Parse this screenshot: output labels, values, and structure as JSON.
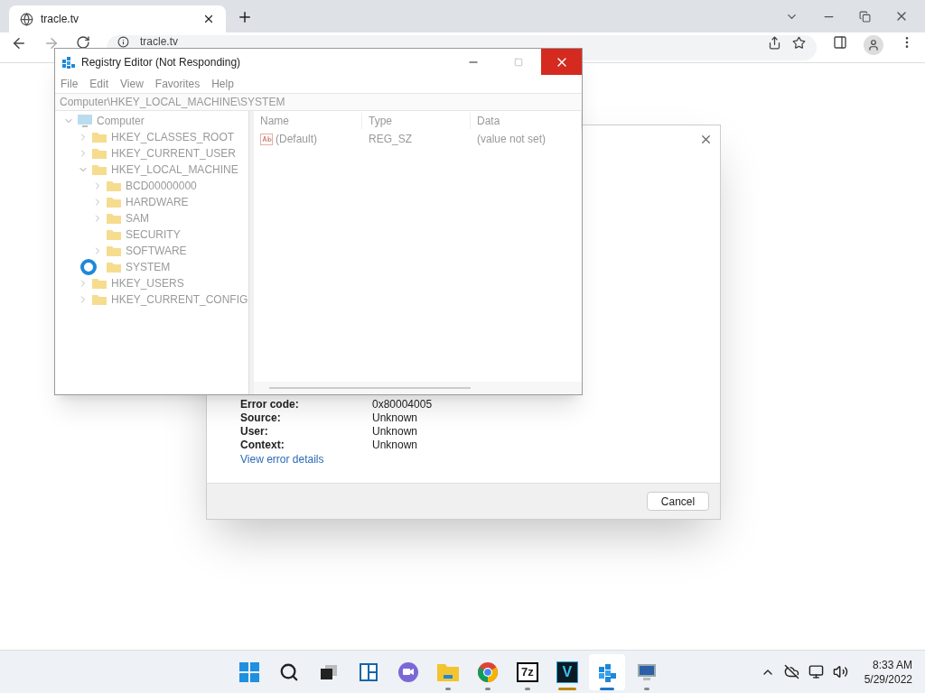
{
  "browser": {
    "tabs": [
      {
        "title": "tracle.tv",
        "selected": true
      }
    ],
    "address": "tracle.tv"
  },
  "dialog": {
    "rows": [
      {
        "label": "Error code:",
        "value": "0x80004005"
      },
      {
        "label": "Source:",
        "value": "Unknown"
      },
      {
        "label": "User:",
        "value": "Unknown"
      },
      {
        "label": "Context:",
        "value": "Unknown"
      }
    ],
    "link": "View error details",
    "button": "Cancel"
  },
  "regedit": {
    "title": "Registry Editor (Not Responding)",
    "menu": [
      "File",
      "Edit",
      "View",
      "Favorites",
      "Help"
    ],
    "address": "Computer\\HKEY_LOCAL_MACHINE\\SYSTEM",
    "tree": [
      {
        "label": "Computer",
        "kind": "computer",
        "expanded": true,
        "children": [
          {
            "label": "HKEY_CLASSES_ROOT",
            "expanded": false
          },
          {
            "label": "HKEY_CURRENT_USER",
            "expanded": false
          },
          {
            "label": "HKEY_LOCAL_MACHINE",
            "expanded": true,
            "children": [
              {
                "label": "BCD00000000",
                "expanded": false
              },
              {
                "label": "HARDWARE",
                "expanded": false
              },
              {
                "label": "SAM",
                "expanded": false
              },
              {
                "label": "SECURITY"
              },
              {
                "label": "SOFTWARE",
                "expanded": false
              },
              {
                "label": "SYSTEM",
                "busy": true
              }
            ]
          },
          {
            "label": "HKEY_USERS",
            "expanded": false
          },
          {
            "label": "HKEY_CURRENT_CONFIG",
            "expanded": false
          }
        ]
      }
    ],
    "columns": [
      "Name",
      "Type",
      "Data"
    ],
    "rows": [
      {
        "name": "(Default)",
        "type": "REG_SZ",
        "data": "(value not set)"
      }
    ]
  },
  "taskbar": {
    "apps": [
      {
        "kind": "start"
      },
      {
        "kind": "search"
      },
      {
        "kind": "taskview"
      },
      {
        "kind": "widgets"
      },
      {
        "kind": "chat"
      },
      {
        "kind": "explorer",
        "running": true
      },
      {
        "kind": "chrome",
        "running": true
      },
      {
        "kind": "sevenzip",
        "label": "7z",
        "running": true
      },
      {
        "kind": "vegas",
        "label": "V",
        "running": true,
        "color": "#b8860b"
      },
      {
        "kind": "regedit",
        "running": true,
        "selected": true
      },
      {
        "kind": "remote",
        "running": true
      }
    ],
    "time": "8:33 AM",
    "date": "5/29/2022"
  }
}
